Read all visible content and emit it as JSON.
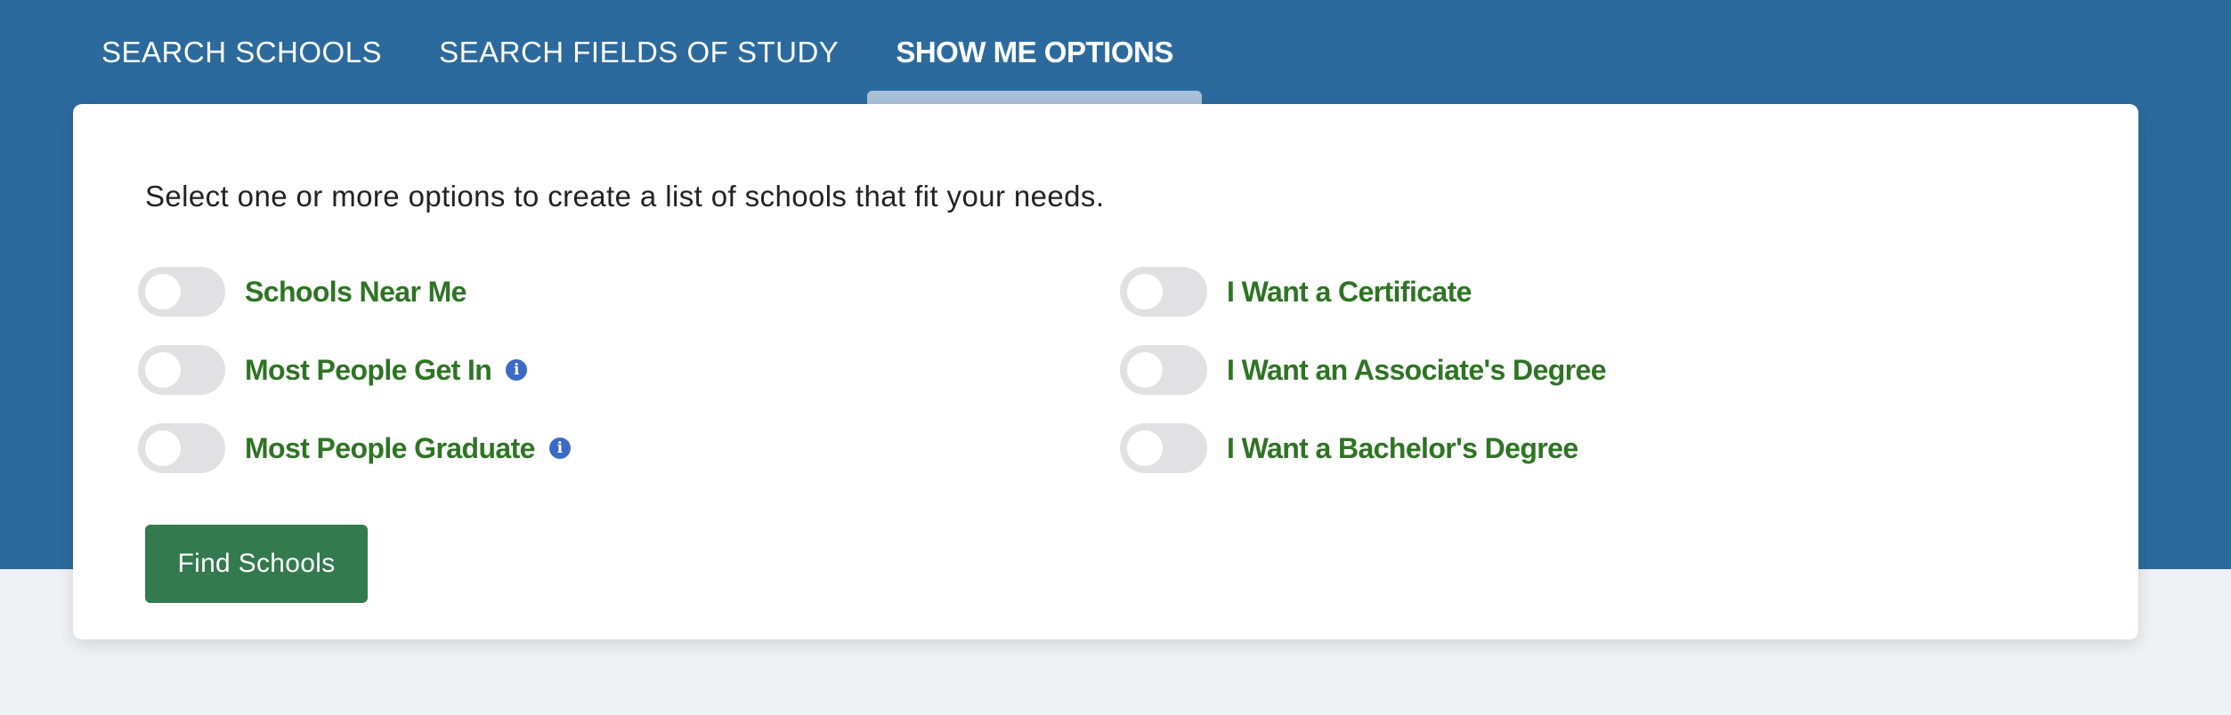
{
  "tabs": [
    {
      "label": "SEARCH SCHOOLS",
      "active": false
    },
    {
      "label": "SEARCH FIELDS OF STUDY",
      "active": false
    },
    {
      "label": "SHOW ME OPTIONS",
      "active": true
    }
  ],
  "panel": {
    "intro": "Select one or more options to create a list of schools that fit your needs.",
    "options_left": [
      {
        "label": "Schools Near Me",
        "info": false,
        "checked": false
      },
      {
        "label": "Most People Get In",
        "info": true,
        "checked": false
      },
      {
        "label": "Most People Graduate",
        "info": true,
        "checked": false
      }
    ],
    "options_right": [
      {
        "label": "I Want a Certificate",
        "checked": false
      },
      {
        "label": "I Want an Associate's Degree",
        "checked": false
      },
      {
        "label": "I Want a Bachelor's Degree",
        "checked": false
      }
    ],
    "submit_label": "Find Schools"
  },
  "icons": {
    "info": "info-icon"
  },
  "colors": {
    "header_blue": "#2c6a9d",
    "option_green": "#2e7424",
    "button_green": "#337a4e",
    "info_blue": "#3b6bc7"
  }
}
